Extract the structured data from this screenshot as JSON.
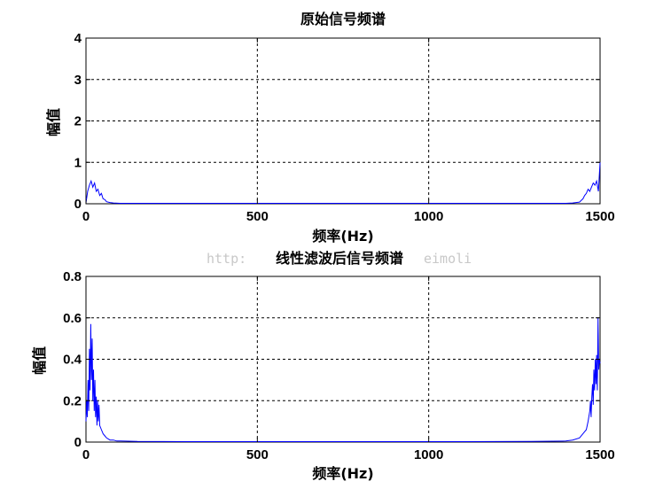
{
  "watermark": {
    "left": "http:",
    "right": "eimoli"
  },
  "chart_data": [
    {
      "type": "line",
      "title": "原始信号频谱",
      "xlabel": "频率(Hz)",
      "ylabel": "幅值",
      "xlim": [
        0,
        1500
      ],
      "ylim": [
        0,
        4
      ],
      "xticks": [
        0,
        500,
        1000,
        1500
      ],
      "yticks": [
        0,
        1,
        2,
        3,
        4
      ],
      "grid": true,
      "color": "#0000ff",
      "x": [
        0,
        5,
        10,
        15,
        20,
        25,
        30,
        35,
        40,
        45,
        50,
        55,
        60,
        70,
        80,
        100,
        200,
        400,
        600,
        800,
        1000,
        1200,
        1400,
        1420,
        1440,
        1445,
        1450,
        1455,
        1460,
        1465,
        1470,
        1475,
        1480,
        1485,
        1490,
        1495,
        1500
      ],
      "values": [
        0.02,
        0.3,
        0.45,
        0.55,
        0.4,
        0.5,
        0.3,
        0.35,
        0.2,
        0.25,
        0.12,
        0.1,
        0.05,
        0.03,
        0.02,
        0.01,
        0.01,
        0.01,
        0.01,
        0.01,
        0.01,
        0.01,
        0.01,
        0.02,
        0.04,
        0.08,
        0.12,
        0.2,
        0.25,
        0.35,
        0.3,
        0.4,
        0.5,
        0.45,
        0.55,
        0.3,
        1.0
      ]
    },
    {
      "type": "line",
      "title": "线性滤波后信号频谱",
      "xlabel": "频率(Hz)",
      "ylabel": "幅值",
      "xlim": [
        0,
        1500
      ],
      "ylim": [
        0,
        0.8
      ],
      "xticks": [
        0,
        500,
        1000,
        1500
      ],
      "yticks": [
        0,
        0.2,
        0.4,
        0.6,
        0.8
      ],
      "grid": true,
      "color": "#0000ff",
      "x": [
        0,
        2,
        4,
        6,
        8,
        10,
        12,
        14,
        16,
        18,
        20,
        22,
        24,
        26,
        28,
        30,
        32,
        34,
        36,
        38,
        40,
        45,
        50,
        55,
        60,
        70,
        80,
        90,
        100,
        150,
        300,
        500,
        700,
        900,
        1100,
        1300,
        1400,
        1420,
        1440,
        1450,
        1460,
        1465,
        1470,
        1472,
        1474,
        1476,
        1478,
        1480,
        1482,
        1484,
        1486,
        1488,
        1490,
        1492,
        1494,
        1496,
        1498,
        1500
      ],
      "values": [
        0.1,
        0.2,
        0.12,
        0.3,
        0.15,
        0.45,
        0.25,
        0.57,
        0.3,
        0.5,
        0.2,
        0.35,
        0.15,
        0.3,
        0.12,
        0.22,
        0.08,
        0.2,
        0.1,
        0.18,
        0.08,
        0.06,
        0.04,
        0.03,
        0.02,
        0.01,
        0.01,
        0.005,
        0.005,
        0.003,
        0.002,
        0.002,
        0.002,
        0.002,
        0.002,
        0.003,
        0.005,
        0.01,
        0.02,
        0.04,
        0.06,
        0.1,
        0.15,
        0.2,
        0.12,
        0.22,
        0.28,
        0.18,
        0.35,
        0.25,
        0.4,
        0.28,
        0.42,
        0.25,
        0.6,
        0.35,
        0.4,
        0.38
      ]
    }
  ]
}
